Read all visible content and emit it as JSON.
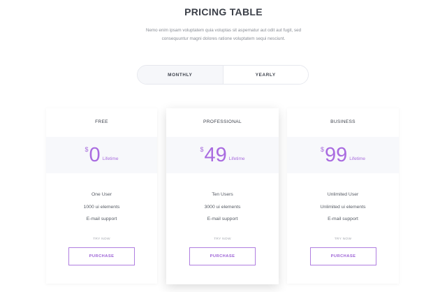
{
  "header": {
    "title": "PRICING TABLE",
    "intro_line1": "Nemo enim ipsam voluptatem quia voluptas sit aspernatur aut odit aut fugit, sed",
    "intro_line2": "consequuntur magni dolores ratione voluptatem sequi nesciunt."
  },
  "toggle": {
    "monthly_label": "MONTHLY",
    "yearly_label": "YEARLY"
  },
  "colors": {
    "accent": "#a96be0",
    "band": "#f7f8fb"
  },
  "plans": [
    {
      "name": "FREE",
      "currency": "$",
      "amount": "0",
      "period": "Lifetime",
      "features": [
        "One User",
        "1000 ui elements",
        "E-mail support"
      ],
      "try_label": "TRY NOW",
      "button_label": "PURCHASE"
    },
    {
      "name": "PROFESSIONAL",
      "currency": "$",
      "amount": "49",
      "period": "Lifetime",
      "features": [
        "Ten Users",
        "3000 ui elements",
        "E-mail support"
      ],
      "try_label": "TRY NOW",
      "button_label": "PURCHASE"
    },
    {
      "name": "BUSINESS",
      "currency": "$",
      "amount": "99",
      "period": "Lifetime",
      "features": [
        "Unlimited User",
        "Unlimited ui elements",
        "E-mail support"
      ],
      "try_label": "TRY NOW",
      "button_label": "PURCHASE"
    }
  ]
}
